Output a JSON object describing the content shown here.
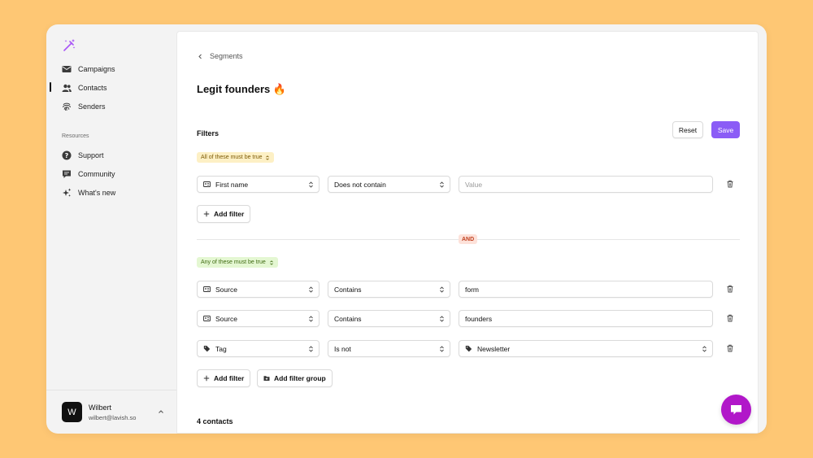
{
  "sidebar": {
    "nav": [
      {
        "label": "Campaigns",
        "icon": "mail-icon"
      },
      {
        "label": "Contacts",
        "icon": "users-icon",
        "active": true
      },
      {
        "label": "Senders",
        "icon": "fingerprint-icon"
      }
    ],
    "resources_label": "Resources",
    "resources": [
      {
        "label": "Support",
        "icon": "help-icon"
      },
      {
        "label": "Community",
        "icon": "chat-icon"
      },
      {
        "label": "What's new",
        "icon": "sparkles-icon"
      }
    ],
    "user": {
      "initial": "W",
      "name": "Wilbert",
      "email": "wilbert@lavish.so"
    }
  },
  "main": {
    "breadcrumb": "Segments",
    "title": "Legit founders 🔥",
    "filters_label": "Filters",
    "reset_label": "Reset",
    "save_label": "Save",
    "group1": {
      "condition": "All of these must be true",
      "rows": [
        {
          "field": "First name",
          "operator": "Does not contain",
          "value": "",
          "placeholder": "Value"
        }
      ],
      "add_filter": "Add filter"
    },
    "joiner": "AND",
    "group2": {
      "condition": "Any of these must be true",
      "rows": [
        {
          "field": "Source",
          "operator": "Contains",
          "value": "form"
        },
        {
          "field": "Source",
          "operator": "Contains",
          "value": "founders"
        },
        {
          "field": "Tag",
          "operator": "Is not",
          "value": "Newsletter"
        }
      ],
      "add_filter": "Add filter",
      "add_filter_group": "Add filter group"
    },
    "contacts_count": "4 contacts"
  },
  "colors": {
    "background": "#FEC774",
    "accent": "#8B5CF6",
    "chat_button": "#B117C9"
  }
}
